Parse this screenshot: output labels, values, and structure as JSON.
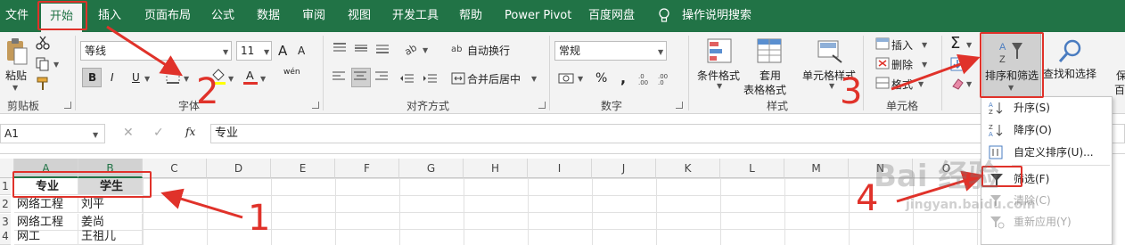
{
  "menu": {
    "tabs": [
      "文件",
      "开始",
      "插入",
      "页面布局",
      "公式",
      "数据",
      "审阅",
      "视图",
      "开发工具",
      "帮助",
      "Power Pivot",
      "百度网盘"
    ],
    "active_tab": "开始",
    "tell_me": "操作说明搜索"
  },
  "ribbon": {
    "clipboard": {
      "paste_label": "粘贴",
      "group_label": "剪贴板"
    },
    "font": {
      "font_name": "等线",
      "font_size": "11",
      "bold": "B",
      "italic": "I",
      "underline": "U",
      "grow": "A",
      "shrink": "A",
      "wen": "wén",
      "group_label": "字体"
    },
    "alignment": {
      "wrap_text": "自动换行",
      "merge_center": "合并后居中",
      "group_label": "对齐方式"
    },
    "number": {
      "format": "常规",
      "percent": "%",
      "comma": ",",
      "group_label": "数字"
    },
    "styles": {
      "conditional_format": "条件格式",
      "table_format_1": "套用",
      "table_format_2": "表格格式",
      "cell_styles": "单元格样式",
      "group_label": "样式"
    },
    "cells": {
      "insert": "插入",
      "delete": "删除",
      "format": "格式",
      "group_label": "单元格"
    },
    "editing": {
      "sort_filter": "排序和筛选",
      "find_select": "查找和选择",
      "partial": "保",
      "partial2": "百"
    }
  },
  "formula_bar": {
    "name_box": "A1",
    "fx": "fx",
    "content": "专业"
  },
  "sheet": {
    "columns": [
      "A",
      "B",
      "C",
      "D",
      "E",
      "F",
      "G",
      "H",
      "I",
      "J",
      "K",
      "L",
      "M",
      "N",
      "O"
    ],
    "rows": [
      {
        "num": "1",
        "a": "专业",
        "b": "学生"
      },
      {
        "num": "2",
        "a": "网络工程",
        "b": "刘平"
      },
      {
        "num": "3",
        "a": "网络工程",
        "b": "姜尚"
      },
      {
        "num": "4",
        "a": "网工",
        "b": "王祖儿"
      }
    ]
  },
  "sort_menu": {
    "items": [
      {
        "label": "升序(S)",
        "disabled": false
      },
      {
        "label": "降序(O)",
        "disabled": false
      },
      {
        "label": "自定义排序(U)...",
        "disabled": false
      },
      {
        "label": "筛选(F)",
        "disabled": false
      },
      {
        "label": "清除(C)",
        "disabled": true
      },
      {
        "label": "重新应用(Y)",
        "disabled": true
      }
    ]
  },
  "annotations": {
    "n1": "1",
    "n2": "2",
    "n3": "3",
    "n4": "4"
  },
  "watermark": {
    "line1": "Bai 经验",
    "line2": "jingyan.baidu.com"
  },
  "colors": {
    "accent": "#217346",
    "annotation": "#e0322a"
  }
}
